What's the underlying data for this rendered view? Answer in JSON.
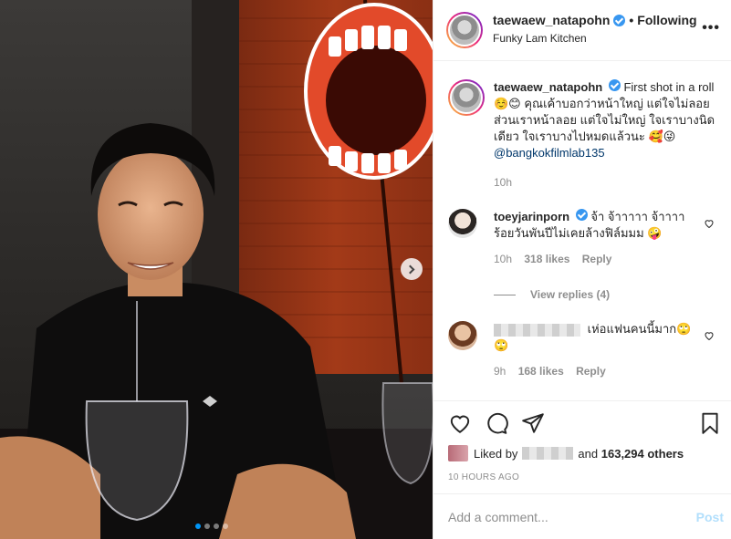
{
  "header": {
    "username": "taewaew_natapohn",
    "separator": "•",
    "follow_label": "Following",
    "location": "Funky Lam Kitchen",
    "more_icon": "more-horizontal-icon"
  },
  "caption": {
    "username": "taewaew_natapohn",
    "text": "First shot in a roll☺️😊 คุณเค้าบอกว่าหน้าใหญ่ แต่ใจไม่ลอย ส่วนเราหน้าลอย แต่ใจไม่ใหญ่ ใจเราบางนิดเดียว ใจเราบางไปหมดแล้วนะ 🥰😜",
    "mention": "@bangkokfilmlab135",
    "time": "10h"
  },
  "comments": [
    {
      "username": "toeyjarinporn",
      "text": "จ้า จ้าาาาา จ้าาาา ร้อยวันพันปีไม่เคยล้างฟิล์มมม 🤪",
      "time": "10h",
      "likes": "318 likes",
      "reply": "Reply",
      "view_replies": "View replies (4)"
    },
    {
      "username": "",
      "text": "เห่อแฟนคนนี้มาก🙄🙄",
      "time": "9h",
      "likes": "168 likes",
      "reply": "Reply"
    }
  ],
  "actions": {
    "liked_by_prefix": "Liked by",
    "liked_by_suffix": "and",
    "others": "163,294 others",
    "timestamp": "10 HOURS AGO"
  },
  "add_comment": {
    "placeholder": "Add a comment...",
    "post_label": "Post"
  },
  "carousel": {
    "slides": 4,
    "active": 1
  },
  "colors": {
    "verified": "#3897f0",
    "link": "#00376b",
    "post": "#b2dffc"
  }
}
